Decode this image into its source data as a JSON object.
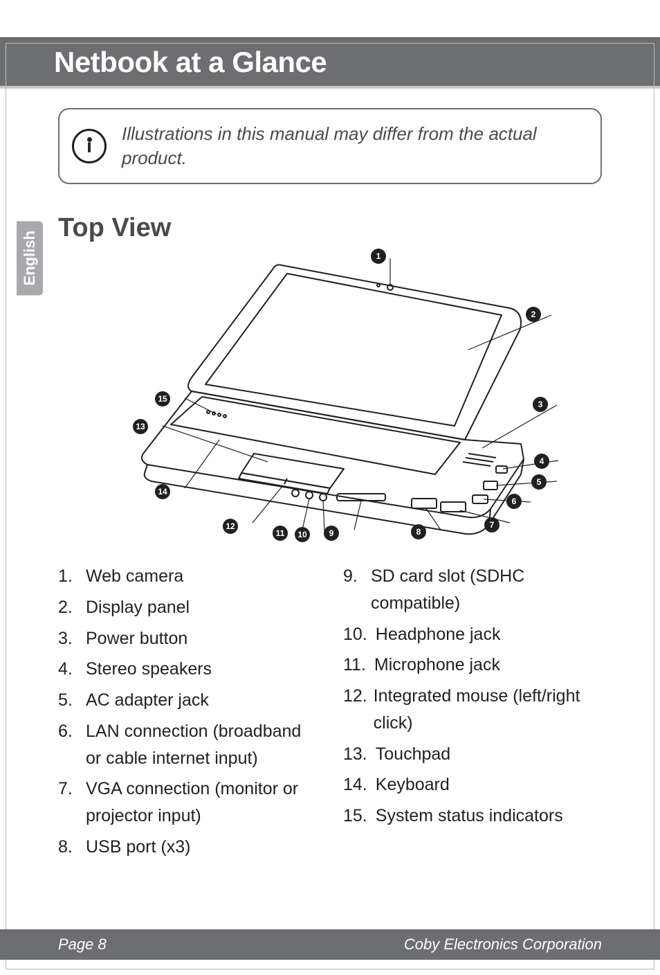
{
  "header": {
    "title": "Netbook at a Glance"
  },
  "side_tab": "English",
  "note": {
    "text": "Illustrations in this manual may differ from the actual product."
  },
  "section": {
    "title": "Top View"
  },
  "callouts": {
    "c1": "1",
    "c2": "2",
    "c3": "3",
    "c4": "4",
    "c5": "5",
    "c6": "6",
    "c7": "7",
    "c8": "8",
    "c9": "9",
    "c10": "10",
    "c11": "11",
    "c12": "12",
    "c13": "13",
    "c14": "14",
    "c15": "15"
  },
  "list_left": [
    {
      "n": "1.",
      "t": "Web camera"
    },
    {
      "n": "2.",
      "t": "Display panel"
    },
    {
      "n": "3.",
      "t": "Power button"
    },
    {
      "n": "4.",
      "t": "Stereo speakers"
    },
    {
      "n": "5.",
      "t": "AC adapter jack"
    },
    {
      "n": "6.",
      "t": "LAN connection (broadband or cable internet input)"
    },
    {
      "n": "7.",
      "t": "VGA connection (monitor or projector input)"
    },
    {
      "n": "8.",
      "t": "USB port (x3)"
    }
  ],
  "list_right": [
    {
      "n": "9.",
      "t": "SD card slot (SDHC compatible)"
    },
    {
      "n": "10.",
      "t": "Headphone jack"
    },
    {
      "n": "11.",
      "t": "Microphone jack"
    },
    {
      "n": "12.",
      "t": "Integrated mouse (left/right click)"
    },
    {
      "n": "13.",
      "t": "Touchpad"
    },
    {
      "n": "14.",
      "t": "Keyboard"
    },
    {
      "n": "15.",
      "t": "System status indicators"
    }
  ],
  "footer": {
    "left": "Page 8",
    "right": "Coby Electronics Corporation"
  }
}
